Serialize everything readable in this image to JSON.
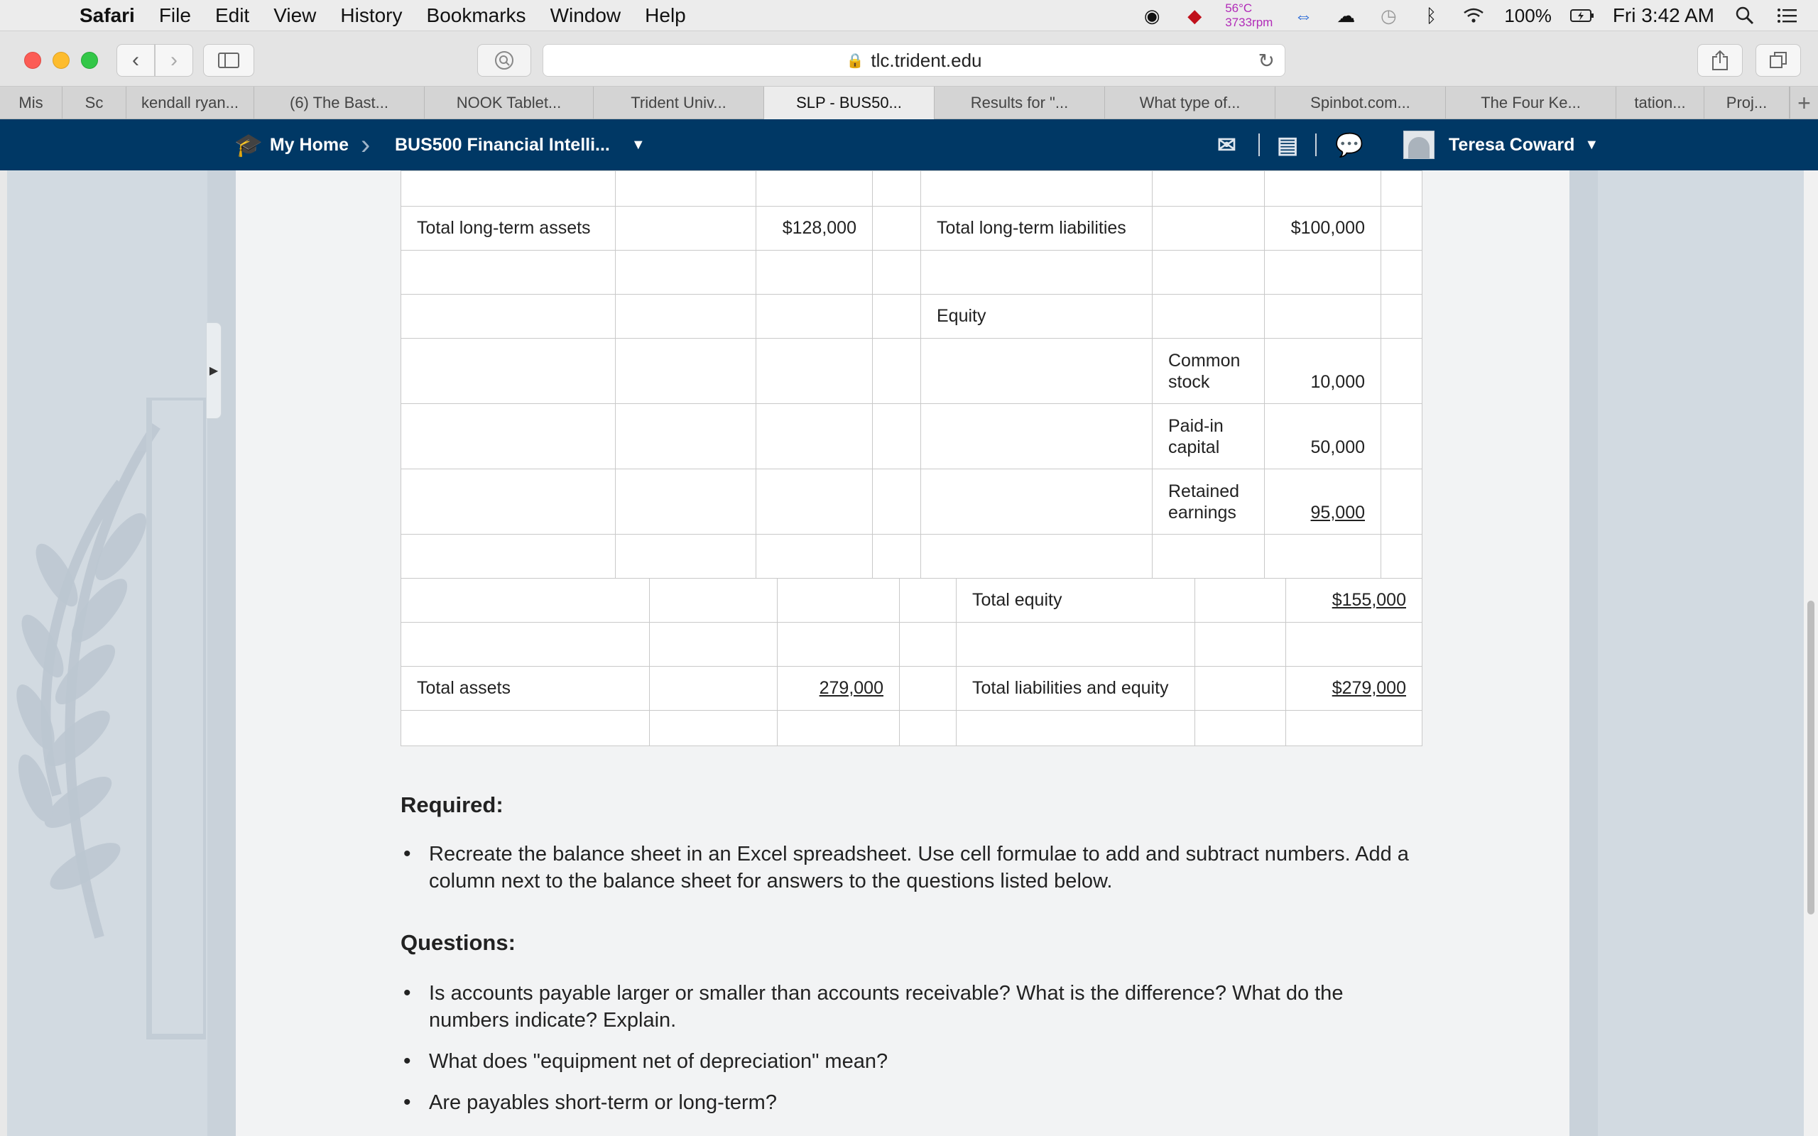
{
  "menubar": {
    "app": "Safari",
    "items": [
      "File",
      "Edit",
      "View",
      "History",
      "Bookmarks",
      "Window",
      "Help"
    ],
    "temp": "56°C",
    "rpm": "3733rpm",
    "battery": "100%",
    "clock": "Fri 3:42 AM"
  },
  "toolbar": {
    "url": "tlc.trident.edu"
  },
  "tabs": [
    {
      "label": "Mis"
    },
    {
      "label": "Sc"
    },
    {
      "label": "kendall ryan..."
    },
    {
      "label": "(6) The Bast..."
    },
    {
      "label": "NOOK Tablet..."
    },
    {
      "label": "Trident Univ..."
    },
    {
      "label": "SLP - BUS50...",
      "active": true
    },
    {
      "label": "Results for \"..."
    },
    {
      "label": "What type of..."
    },
    {
      "label": "Spinbot.com..."
    },
    {
      "label": "The Four Ke..."
    },
    {
      "label": "tation..."
    },
    {
      "label": "Proj..."
    }
  ],
  "sitenav": {
    "home": "My Home",
    "course": "BUS500 Financial Intelli...",
    "user": "Teresa Coward"
  },
  "sheet": {
    "total_lt_assets_label": "Total long-term assets",
    "total_lt_assets_value": "$128,000",
    "total_lt_liab_label": "Total long-term liabilities",
    "total_lt_liab_value": "$100,000",
    "equity_label": "Equity",
    "common_stock_label": "Common stock",
    "common_stock_value": "10,000",
    "paid_in_label": "Paid-in capital",
    "paid_in_value": "50,000",
    "retained_label": "Retained earnings",
    "retained_value": "95,000",
    "total_equity_label": "Total equity",
    "total_equity_value": "$155,000",
    "total_assets_label": "Total assets",
    "total_assets_value": "279,000",
    "total_le_label": "Total liabilities and equity",
    "total_le_value": "$279,000"
  },
  "required": {
    "heading": "Required:",
    "items": [
      "Recreate the balance sheet in an Excel spreadsheet. Use cell formulae to add and subtract numbers. Add a column next to the balance sheet for answers to the questions listed below."
    ]
  },
  "questions": {
    "heading": "Questions:",
    "items": [
      "Is accounts payable larger or smaller than accounts receivable? What is the difference? What do the numbers indicate? Explain.",
      "What does \"equipment net of depreciation\" mean?",
      "Are payables short-term or long-term?"
    ]
  }
}
